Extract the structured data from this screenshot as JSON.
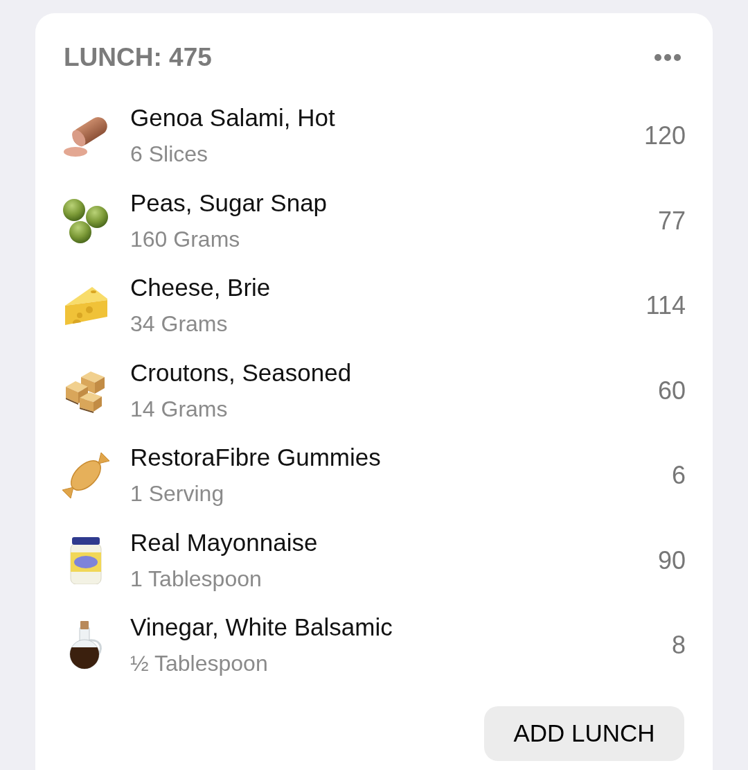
{
  "meal": {
    "title": "LUNCH: 475"
  },
  "foods": [
    {
      "kind": "salami",
      "name": "Genoa Salami, Hot",
      "serving": "6 Slices",
      "calories": "120"
    },
    {
      "kind": "peas",
      "name": "Peas, Sugar Snap",
      "serving": "160 Grams",
      "calories": "77"
    },
    {
      "kind": "cheese",
      "name": "Cheese, Brie",
      "serving": "34 Grams",
      "calories": "114"
    },
    {
      "kind": "croutons",
      "name": "Croutons, Seasoned",
      "serving": "14 Grams",
      "calories": "60"
    },
    {
      "kind": "candy",
      "name": "RestoraFibre Gummies",
      "serving": "1 Serving",
      "calories": "6"
    },
    {
      "kind": "jar",
      "name": "Real Mayonnaise",
      "serving": "1 Tablespoon",
      "calories": "90"
    },
    {
      "kind": "cruet",
      "name": "Vinegar, White Balsamic",
      "serving": "½ Tablespoon",
      "calories": "8"
    }
  ],
  "button": {
    "label": "ADD LUNCH"
  }
}
